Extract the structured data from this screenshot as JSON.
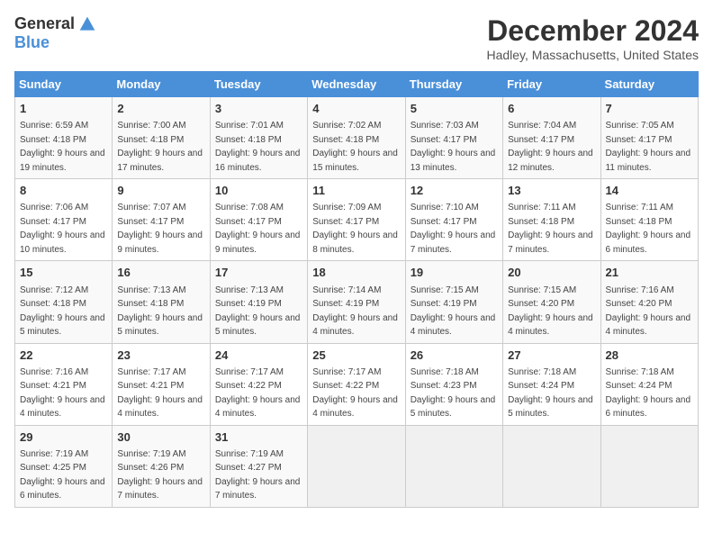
{
  "logo": {
    "general": "General",
    "blue": "Blue"
  },
  "title": "December 2024",
  "location": "Hadley, Massachusetts, United States",
  "days_of_week": [
    "Sunday",
    "Monday",
    "Tuesday",
    "Wednesday",
    "Thursday",
    "Friday",
    "Saturday"
  ],
  "weeks": [
    [
      {
        "day": "1",
        "sunrise": "6:59 AM",
        "sunset": "4:18 PM",
        "daylight": "9 hours and 19 minutes."
      },
      {
        "day": "2",
        "sunrise": "7:00 AM",
        "sunset": "4:18 PM",
        "daylight": "9 hours and 17 minutes."
      },
      {
        "day": "3",
        "sunrise": "7:01 AM",
        "sunset": "4:18 PM",
        "daylight": "9 hours and 16 minutes."
      },
      {
        "day": "4",
        "sunrise": "7:02 AM",
        "sunset": "4:18 PM",
        "daylight": "9 hours and 15 minutes."
      },
      {
        "day": "5",
        "sunrise": "7:03 AM",
        "sunset": "4:17 PM",
        "daylight": "9 hours and 13 minutes."
      },
      {
        "day": "6",
        "sunrise": "7:04 AM",
        "sunset": "4:17 PM",
        "daylight": "9 hours and 12 minutes."
      },
      {
        "day": "7",
        "sunrise": "7:05 AM",
        "sunset": "4:17 PM",
        "daylight": "9 hours and 11 minutes."
      }
    ],
    [
      {
        "day": "8",
        "sunrise": "7:06 AM",
        "sunset": "4:17 PM",
        "daylight": "9 hours and 10 minutes."
      },
      {
        "day": "9",
        "sunrise": "7:07 AM",
        "sunset": "4:17 PM",
        "daylight": "9 hours and 9 minutes."
      },
      {
        "day": "10",
        "sunrise": "7:08 AM",
        "sunset": "4:17 PM",
        "daylight": "9 hours and 9 minutes."
      },
      {
        "day": "11",
        "sunrise": "7:09 AM",
        "sunset": "4:17 PM",
        "daylight": "9 hours and 8 minutes."
      },
      {
        "day": "12",
        "sunrise": "7:10 AM",
        "sunset": "4:17 PM",
        "daylight": "9 hours and 7 minutes."
      },
      {
        "day": "13",
        "sunrise": "7:11 AM",
        "sunset": "4:18 PM",
        "daylight": "9 hours and 7 minutes."
      },
      {
        "day": "14",
        "sunrise": "7:11 AM",
        "sunset": "4:18 PM",
        "daylight": "9 hours and 6 minutes."
      }
    ],
    [
      {
        "day": "15",
        "sunrise": "7:12 AM",
        "sunset": "4:18 PM",
        "daylight": "9 hours and 5 minutes."
      },
      {
        "day": "16",
        "sunrise": "7:13 AM",
        "sunset": "4:18 PM",
        "daylight": "9 hours and 5 minutes."
      },
      {
        "day": "17",
        "sunrise": "7:13 AM",
        "sunset": "4:19 PM",
        "daylight": "9 hours and 5 minutes."
      },
      {
        "day": "18",
        "sunrise": "7:14 AM",
        "sunset": "4:19 PM",
        "daylight": "9 hours and 4 minutes."
      },
      {
        "day": "19",
        "sunrise": "7:15 AM",
        "sunset": "4:19 PM",
        "daylight": "9 hours and 4 minutes."
      },
      {
        "day": "20",
        "sunrise": "7:15 AM",
        "sunset": "4:20 PM",
        "daylight": "9 hours and 4 minutes."
      },
      {
        "day": "21",
        "sunrise": "7:16 AM",
        "sunset": "4:20 PM",
        "daylight": "9 hours and 4 minutes."
      }
    ],
    [
      {
        "day": "22",
        "sunrise": "7:16 AM",
        "sunset": "4:21 PM",
        "daylight": "9 hours and 4 minutes."
      },
      {
        "day": "23",
        "sunrise": "7:17 AM",
        "sunset": "4:21 PM",
        "daylight": "9 hours and 4 minutes."
      },
      {
        "day": "24",
        "sunrise": "7:17 AM",
        "sunset": "4:22 PM",
        "daylight": "9 hours and 4 minutes."
      },
      {
        "day": "25",
        "sunrise": "7:17 AM",
        "sunset": "4:22 PM",
        "daylight": "9 hours and 4 minutes."
      },
      {
        "day": "26",
        "sunrise": "7:18 AM",
        "sunset": "4:23 PM",
        "daylight": "9 hours and 5 minutes."
      },
      {
        "day": "27",
        "sunrise": "7:18 AM",
        "sunset": "4:24 PM",
        "daylight": "9 hours and 5 minutes."
      },
      {
        "day": "28",
        "sunrise": "7:18 AM",
        "sunset": "4:24 PM",
        "daylight": "9 hours and 6 minutes."
      }
    ],
    [
      {
        "day": "29",
        "sunrise": "7:19 AM",
        "sunset": "4:25 PM",
        "daylight": "9 hours and 6 minutes."
      },
      {
        "day": "30",
        "sunrise": "7:19 AM",
        "sunset": "4:26 PM",
        "daylight": "9 hours and 7 minutes."
      },
      {
        "day": "31",
        "sunrise": "7:19 AM",
        "sunset": "4:27 PM",
        "daylight": "9 hours and 7 minutes."
      },
      null,
      null,
      null,
      null
    ]
  ],
  "labels": {
    "sunrise": "Sunrise:",
    "sunset": "Sunset:",
    "daylight": "Daylight:"
  }
}
